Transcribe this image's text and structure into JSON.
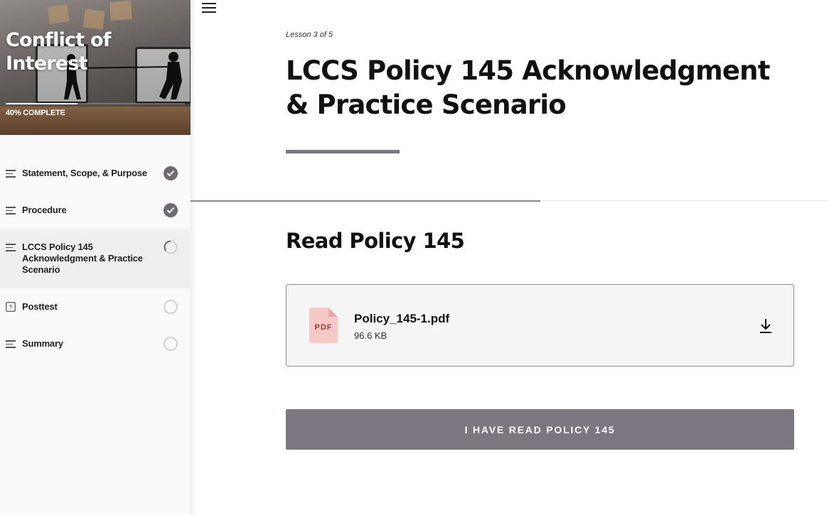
{
  "course": {
    "title": "Conflict of Interest",
    "progress_percent": 40,
    "progress_label": "40% COMPLETE"
  },
  "sidebar": {
    "lessons": [
      {
        "label": "Statement, Scope, & Purpose",
        "icon": "lines-icon",
        "status": "complete"
      },
      {
        "label": "Procedure",
        "icon": "lines-icon",
        "status": "complete"
      },
      {
        "label": "LCCS Policy 145 Acknowledgment & Practice Scenario",
        "icon": "lines-icon",
        "status": "in-progress",
        "active": true
      },
      {
        "label": "Posttest",
        "icon": "quiz-icon",
        "status": "not-started"
      },
      {
        "label": "Summary",
        "icon": "lines-icon",
        "status": "not-started"
      }
    ]
  },
  "lesson": {
    "count_label": "Lesson 3 of 5",
    "title": "LCCS Policy 145 Acknowledgment & Practice Scenario"
  },
  "content": {
    "section_heading": "Read Policy 145",
    "attachment": {
      "file_name": "Policy_145-1.pdf",
      "file_size": "96.6 KB",
      "type_label": "PDF"
    },
    "continue_label": "I HAVE READ POLICY 145"
  },
  "colors": {
    "accent": "#7b767f",
    "check": "#6d6a70",
    "pdf_icon": "#f6c9c6",
    "pdf_text": "#a03a32"
  }
}
